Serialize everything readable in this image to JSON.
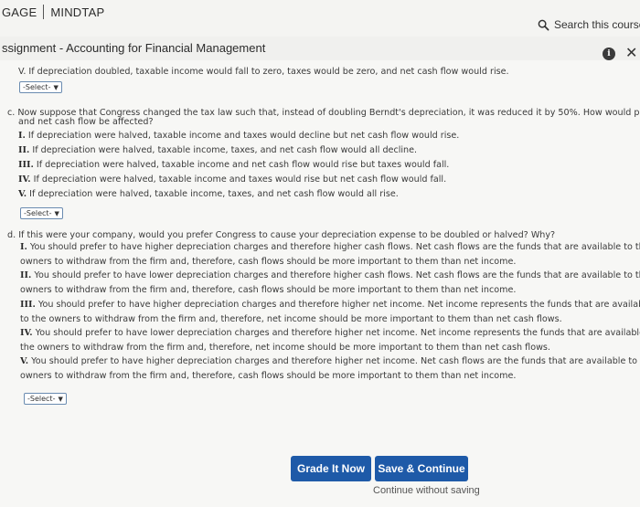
{
  "header": {
    "brand_left": "GAGE",
    "brand_right": "MINDTAP",
    "search_label": "Search this course"
  },
  "assignment": {
    "title": "ssignment - Accounting for Financial Management"
  },
  "part_b_last": "V. If depreciation doubled, taxable income would fall to zero, taxes would be zero, and net cash flow would rise.",
  "select_label": "-Select-",
  "part_c": {
    "q1": "c. Now suppose that Congress changed the tax law such that, instead of doubling Berndt's depreciation, it was reduced it by 50%. How would profit",
    "q2": "and net cash flow be affected?",
    "options": [
      {
        "num": "I.",
        "text": "If depreciation were halved, taxable income and taxes would decline but net cash flow would rise."
      },
      {
        "num": "II.",
        "text": "If depreciation were halved, taxable income, taxes, and net cash flow would all decline."
      },
      {
        "num": "III.",
        "text": "If depreciation were halved, taxable income and net cash flow would rise but taxes would fall."
      },
      {
        "num": "IV.",
        "text": "If depreciation were halved, taxable income and taxes would rise but net cash flow would fall."
      },
      {
        "num": "V.",
        "text": "If depreciation were halved, taxable income, taxes, and net cash flow would all rise."
      }
    ]
  },
  "part_d": {
    "q": "d. If this were your company, would you prefer Congress to cause your depreciation expense to be doubled or halved? Why?",
    "options": [
      {
        "num": "I.",
        "l1": "You should prefer to have higher depreciation charges and therefore higher cash flows. Net cash flows are the funds that are available to the",
        "l2": "owners to withdraw from the firm and, therefore, cash flows should be more important to them than net income."
      },
      {
        "num": "II.",
        "l1": "You should prefer to have lower depreciation charges and therefore higher cash flows. Net cash flows are the funds that are available to the",
        "l2": "owners to withdraw from the firm and, therefore, cash flows should be more important to them than net income."
      },
      {
        "num": "III.",
        "l1": "You should prefer to have higher depreciation charges and therefore higher net income. Net income represents the funds that are available",
        "l2": "to the owners to withdraw from the firm and, therefore, net income should be more important to them than net cash flows."
      },
      {
        "num": "IV.",
        "l1": "You should prefer to have lower depreciation charges and therefore higher net income. Net income represents the funds that are available to",
        "l2": "the owners to withdraw from the firm and, therefore, net income should be more important to them than net cash flows."
      },
      {
        "num": "V.",
        "l1": "You should prefer to have higher depreciation charges and therefore higher net income. Net cash flows are the funds that are available to the",
        "l2": "owners to withdraw from the firm and, therefore, cash flows should be more important to them than net income."
      }
    ]
  },
  "footer": {
    "grade_label": "Grade It Now",
    "save_label": "Save & Continue",
    "continue_label": "Continue without saving"
  },
  "colors": {
    "accent": "#1e5aa8"
  }
}
